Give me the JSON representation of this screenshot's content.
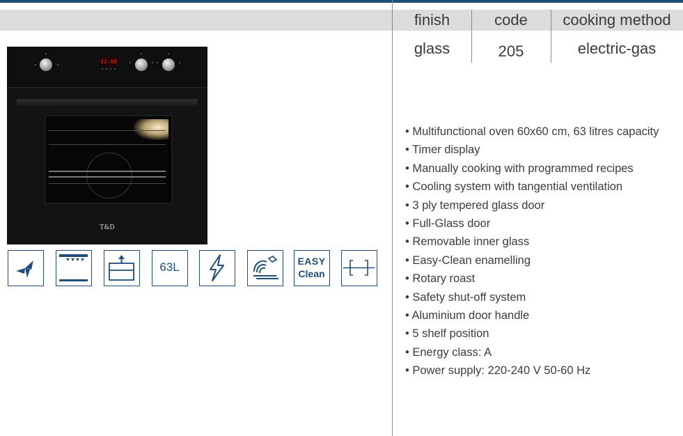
{
  "spec_table": {
    "headers": [
      "finish",
      "code",
      "cooking method"
    ],
    "values": [
      "glass",
      "205",
      "electric-gas"
    ]
  },
  "features": [
    "• Multifunctional oven 60x60 cm, 63 litres capacity",
    "• Timer display",
    "• Manually cooking with programmed recipes",
    "• Cooling system with tangential ventilation",
    "• 3 ply tempered glass door",
    "• Full-Glass door",
    "• Removable inner glass",
    "• Easy-Clean enamelling",
    "• Rotary roast",
    "• Safety shut-off system",
    "• Aluminium door handle",
    "• 5 shelf position",
    "• Energy class: A",
    "• Power supply: 220-240 V 50-60 Hz"
  ],
  "oven": {
    "brand": "T&D",
    "display": "12:00"
  },
  "icons": [
    {
      "name": "fan-icon"
    },
    {
      "name": "top-heat-icon"
    },
    {
      "name": "drawer-icon"
    },
    {
      "name": "capacity-icon",
      "label": "63L"
    },
    {
      "name": "lightning-icon"
    },
    {
      "name": "fan-wave-icon"
    },
    {
      "name": "easy-clean-icon",
      "label_line1": "EASY",
      "label_line2": "Clean"
    },
    {
      "name": "width-icon"
    }
  ],
  "colors": {
    "accent": "#1f4e79",
    "header_bar": "#dcdcdc"
  }
}
